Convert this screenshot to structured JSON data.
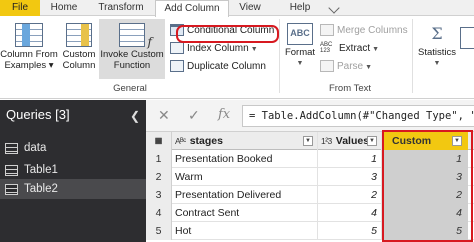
{
  "tabs": {
    "file": "File",
    "home": "Home",
    "transform": "Transform",
    "add_column": "Add Column",
    "view": "View",
    "help": "Help"
  },
  "ribbon": {
    "general": {
      "column_from_examples": [
        "Column From",
        "Examples ▾"
      ],
      "custom_column": [
        "Custom",
        "Column"
      ],
      "invoke_custom_function": [
        "Invoke Custom",
        "Function"
      ],
      "conditional_column": "Conditional Column",
      "index_column": "Index Column",
      "duplicate_column": "Duplicate Column",
      "group_label": "General"
    },
    "from_text": {
      "format": "Format",
      "extract": "Extract",
      "merge_columns": "Merge Columns",
      "parse": "Parse",
      "group_label": "From Text"
    },
    "statistics": "Statistics",
    "abc_icon_label": "ABC\n123"
  },
  "queries": {
    "title": "Queries [3]",
    "items": [
      "data",
      "Table1",
      "Table2"
    ],
    "selected": "Table2"
  },
  "formula": {
    "fx": "fx",
    "text": "= Table.AddColumn(#\"Changed Type\", \"Cust"
  },
  "table": {
    "headers": {
      "stages": "stages",
      "stages_type": "Aᴮᶜ",
      "values": "Values",
      "values_type": "1²3",
      "custom": "Custom"
    },
    "rows": [
      {
        "n": "1",
        "stage": "Presentation Booked",
        "value": "1",
        "custom": "1"
      },
      {
        "n": "2",
        "stage": "Warm",
        "value": "3",
        "custom": "3"
      },
      {
        "n": "3",
        "stage": "Presentation Delivered",
        "value": "2",
        "custom": "2"
      },
      {
        "n": "4",
        "stage": "Contract Sent",
        "value": "4",
        "custom": "4"
      },
      {
        "n": "5",
        "stage": "Hot",
        "value": "5",
        "custom": "5"
      }
    ]
  },
  "colors": {
    "accent_yellow": "#f2c811",
    "highlight_red": "#d71920",
    "sidebar": "#2d2d30"
  }
}
